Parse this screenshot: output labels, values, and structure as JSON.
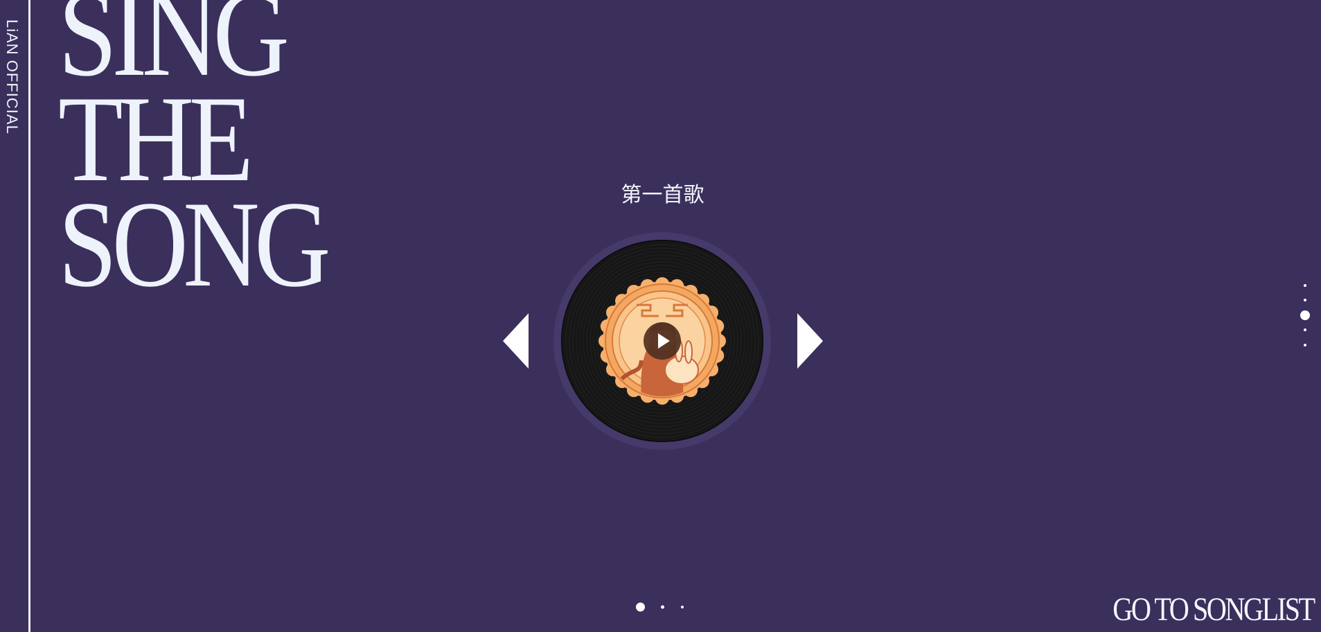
{
  "brand": {
    "name": "LiAN OFFICIAL"
  },
  "hero": {
    "lines": [
      "SING",
      "THE",
      "SONG"
    ]
  },
  "player": {
    "song_title": "第一首歌",
    "prev_icon": "triangle-left-icon",
    "next_icon": "triangle-right-icon",
    "play_icon": "play-icon"
  },
  "section_nav": {
    "count": 5,
    "active_index": 2
  },
  "slide_nav": {
    "count": 3,
    "active_index": 0
  },
  "cta": {
    "label": "GO TO SONGLIST"
  },
  "colors": {
    "background": "#3b2f5c",
    "text": "#eef3fb",
    "record": "#161616",
    "label_orange": "#f2a35f"
  }
}
